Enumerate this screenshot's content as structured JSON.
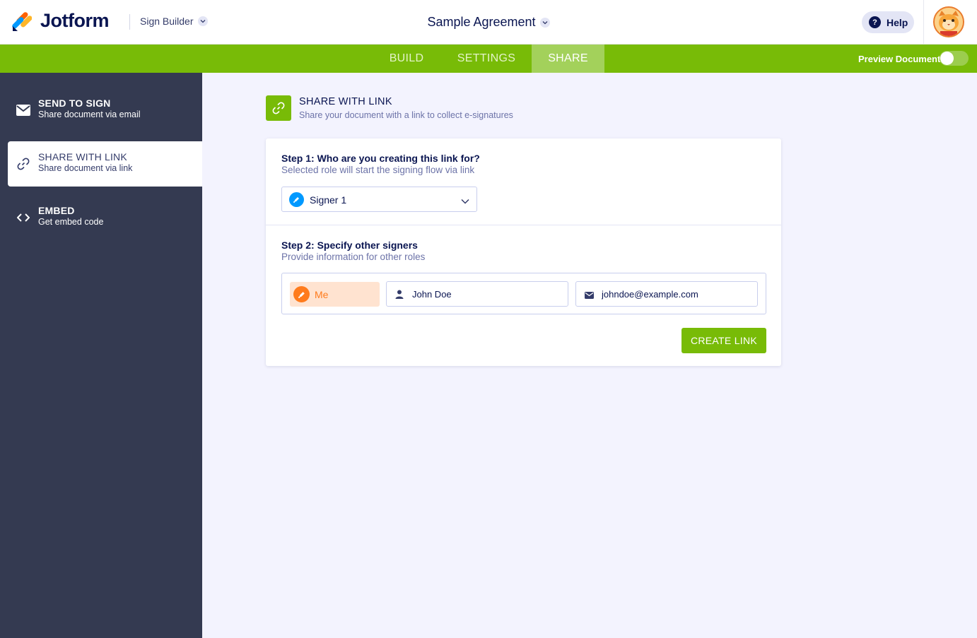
{
  "header": {
    "brand": "Jotform",
    "product": "Sign Builder",
    "document_title": "Sample Agreement",
    "help_label": "Help"
  },
  "nav": {
    "tabs": [
      {
        "label": "BUILD",
        "active": false
      },
      {
        "label": "SETTINGS",
        "active": false
      },
      {
        "label": "SHARE",
        "active": true
      }
    ],
    "preview_label": "Preview Document",
    "preview_on": false
  },
  "sidebar": {
    "items": [
      {
        "title": "SEND TO SIGN",
        "subtitle": "Share document via email",
        "icon": "envelope-icon",
        "active": false
      },
      {
        "title": "SHARE WITH LINK",
        "subtitle": "Share document via link",
        "icon": "link-icon",
        "active": true
      },
      {
        "title": "EMBED",
        "subtitle": "Get embed code",
        "icon": "code-icon",
        "active": false
      }
    ]
  },
  "main": {
    "section_title": "SHARE WITH LINK",
    "section_subtitle": "Share your document with a link to collect e-signatures",
    "step1": {
      "title": "Step 1: Who are you creating this link for?",
      "subtitle": "Selected role will start the signing flow via link",
      "selected_role": "Signer 1"
    },
    "step2": {
      "title": "Step 2: Specify other signers",
      "subtitle": "Provide information for other roles",
      "role_label": "Me",
      "name_value": "John Doe",
      "email_value": "johndoe@example.com"
    },
    "create_button": "CREATE LINK"
  },
  "colors": {
    "brand_green": "#78bb07",
    "sidebar_bg": "#343a51",
    "navy": "#0a1551",
    "signer_blue": "#0099ff",
    "me_orange": "#ff7b1c"
  }
}
